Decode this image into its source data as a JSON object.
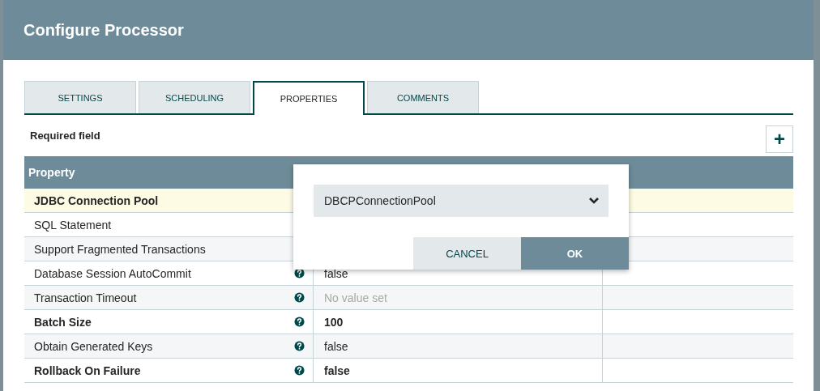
{
  "dialog": {
    "title": "Configure Processor"
  },
  "tabs": [
    {
      "label": "SETTINGS",
      "selected": false
    },
    {
      "label": "SCHEDULING",
      "selected": false
    },
    {
      "label": "PROPERTIES",
      "selected": true
    },
    {
      "label": "COMMENTS",
      "selected": false
    }
  ],
  "required_label": "Required field",
  "add_button": {
    "label": "+"
  },
  "table": {
    "columns": [
      "Property"
    ],
    "rows": [
      {
        "name": "JDBC Connection Pool",
        "required": true,
        "selected": true
      },
      {
        "name": "SQL Statement",
        "required": false,
        "selected": false
      },
      {
        "name": "Support Fragmented Transactions",
        "required": false,
        "selected": false
      },
      {
        "name": "Database Session AutoCommit",
        "required": false,
        "selected": false,
        "value": "false",
        "unset": false
      },
      {
        "name": "Transaction Timeout",
        "required": false,
        "selected": false,
        "value": "No value set",
        "unset": true
      },
      {
        "name": "Batch Size",
        "required": true,
        "selected": false,
        "value": "100",
        "unset": false
      },
      {
        "name": "Obtain Generated Keys",
        "required": false,
        "selected": false,
        "value": "false",
        "unset": false
      },
      {
        "name": "Rollback On Failure",
        "required": true,
        "selected": false,
        "value": "false",
        "unset": false
      }
    ]
  },
  "editor": {
    "value": "DBCPConnectionPool",
    "buttons": [
      {
        "label": "CANCEL",
        "kind": "secondary"
      },
      {
        "label": "OK",
        "kind": "primary"
      }
    ]
  }
}
